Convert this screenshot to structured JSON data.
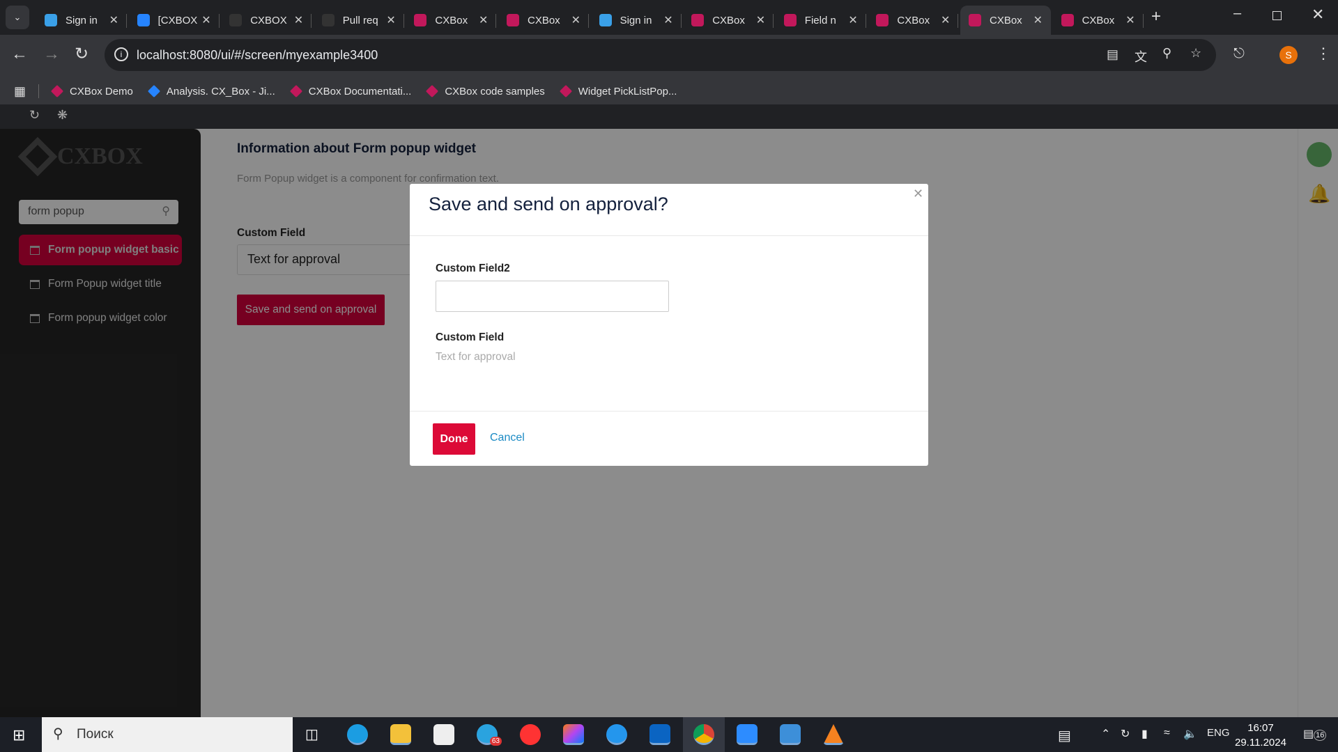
{
  "browser": {
    "tabs": [
      {
        "label": "Sign in",
        "color": "#3aa0e8"
      },
      {
        "label": "[CXBOX",
        "color": "#2684ff"
      },
      {
        "label": "CXBOX",
        "color": "#333"
      },
      {
        "label": "Pull req",
        "color": "#333"
      },
      {
        "label": "CXBox",
        "color": "#c2185b"
      },
      {
        "label": "CXBox",
        "color": "#c2185b"
      },
      {
        "label": "Sign in",
        "color": "#3aa0e8"
      },
      {
        "label": "CXBox",
        "color": "#c2185b"
      },
      {
        "label": "Field n",
        "color": "#c2185b"
      },
      {
        "label": "CXBox",
        "color": "#c2185b"
      },
      {
        "label": "CXBox",
        "color": "#c2185b",
        "active": true
      },
      {
        "label": "CXBox",
        "color": "#c2185b"
      }
    ],
    "url": "localhost:8080/ui/#/screen/myexample3400",
    "profile_initial": "S",
    "bookmarks": [
      "CXBox Demo",
      "Analysis. CX_Box - Ji...",
      "CXBox Documentati...",
      "CXBox code samples",
      "Widget PickListPop..."
    ]
  },
  "sidebar": {
    "logo": "CXBOX",
    "search_value": "form popup",
    "items": [
      {
        "label": "Form popup widget basic",
        "active": true
      },
      {
        "label": "Form Popup widget title"
      },
      {
        "label": "Form popup widget color"
      }
    ]
  },
  "main": {
    "title": "Information about Form popup widget",
    "description": "Form Popup widget is a component for confirmation text.",
    "field_label": "Custom Field",
    "field_value": "Text for approval",
    "button_label": "Save and send on approval"
  },
  "modal": {
    "title": "Save and send on approval?",
    "field2_label": "Custom Field2",
    "field2_value": "",
    "field_label": "Custom Field",
    "field_value": "Text for approval",
    "done_label": "Done",
    "cancel_label": "Cancel"
  },
  "taskbar": {
    "search_placeholder": "Поиск",
    "telegram_badge": "63",
    "language": "ENG",
    "time": "16:07",
    "date": "29.11.2024",
    "notifications": "16"
  },
  "colors": {
    "accent": "#dc0a37",
    "link": "#1a8ac4"
  }
}
